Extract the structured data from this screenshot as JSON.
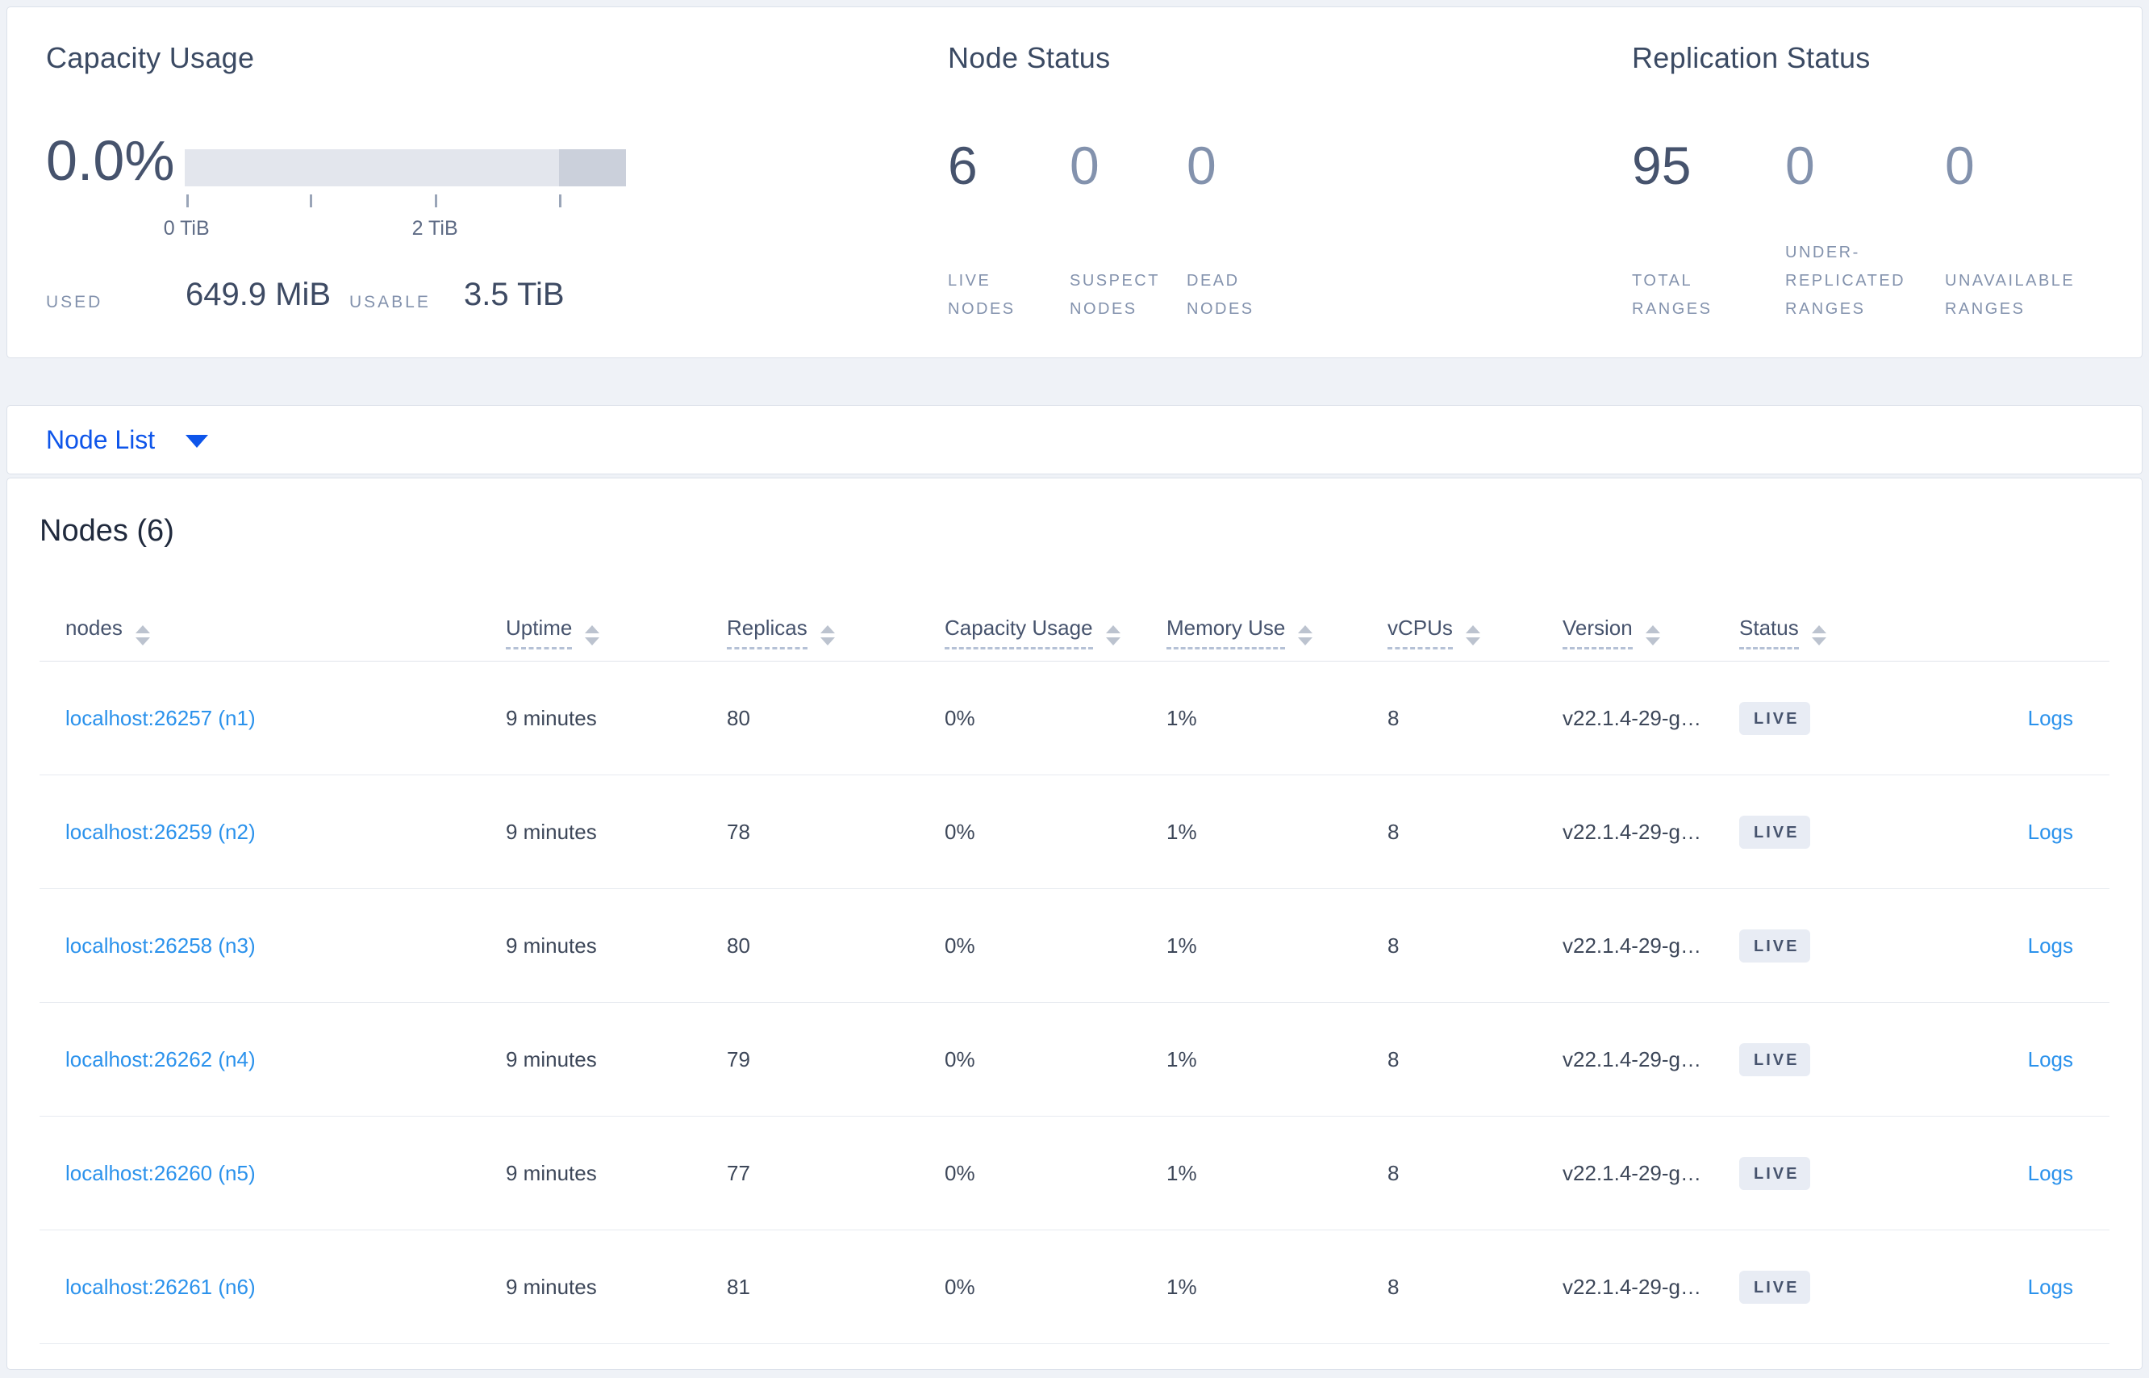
{
  "theme": {
    "accent_blue": "#0e55ea",
    "link_blue": "#2b92ec",
    "badge_bg": "#e8ecf4",
    "text_dark": "#46536d",
    "text_muted": "#8392ad"
  },
  "summary": {
    "capacity": {
      "title": "Capacity Usage",
      "percent": "0.0%",
      "used_label": "USED",
      "used_value": "649.9 MiB",
      "usable_label": "USABLE",
      "usable_value": "3.5 TiB",
      "bar": {
        "segments": [
          {
            "shade": "light",
            "width_pct": 84.8
          },
          {
            "shade": "dark",
            "width_pct": 15.2
          }
        ],
        "ticks": [
          {
            "pct": 0.4,
            "label": "0 TiB"
          },
          {
            "pct": 28.3,
            "label": ""
          },
          {
            "pct": 56.7,
            "label": "2 TiB"
          },
          {
            "pct": 84.8,
            "label": ""
          }
        ]
      }
    },
    "node_status": {
      "title": "Node Status",
      "metrics": [
        {
          "value": "6",
          "muted": false,
          "lines": [
            "LIVE",
            "NODES"
          ]
        },
        {
          "value": "0",
          "muted": true,
          "lines": [
            "SUSPECT",
            "NODES"
          ]
        },
        {
          "value": "0",
          "muted": true,
          "lines": [
            "DEAD",
            "NODES"
          ]
        }
      ]
    },
    "replication": {
      "title": "Replication Status",
      "metrics": [
        {
          "value": "95",
          "muted": false,
          "lines": [
            "TOTAL",
            "RANGES"
          ]
        },
        {
          "value": "0",
          "muted": true,
          "lines": [
            "UNDER-",
            "REPLICATED",
            "RANGES"
          ]
        },
        {
          "value": "0",
          "muted": true,
          "lines": [
            "UNAVAILABLE",
            "RANGES"
          ]
        }
      ]
    }
  },
  "node_list": {
    "label": "Node List"
  },
  "table": {
    "title": "Nodes (6)",
    "columns": [
      {
        "label": "nodes",
        "dashed": false
      },
      {
        "label": "Uptime",
        "dashed": true
      },
      {
        "label": "Replicas",
        "dashed": true
      },
      {
        "label": "Capacity Usage",
        "dashed": true
      },
      {
        "label": "Memory Use",
        "dashed": true
      },
      {
        "label": "vCPUs",
        "dashed": true
      },
      {
        "label": "Version",
        "dashed": true
      },
      {
        "label": "Status",
        "dashed": true
      }
    ],
    "rows": [
      {
        "node": "localhost:26257 (n1)",
        "uptime": "9 minutes",
        "replicas": "80",
        "capacity": "0%",
        "memory": "1%",
        "vcpus": "8",
        "version": "v22.1.4-29-g…",
        "status": "LIVE",
        "logs": "Logs"
      },
      {
        "node": "localhost:26259 (n2)",
        "uptime": "9 minutes",
        "replicas": "78",
        "capacity": "0%",
        "memory": "1%",
        "vcpus": "8",
        "version": "v22.1.4-29-g…",
        "status": "LIVE",
        "logs": "Logs"
      },
      {
        "node": "localhost:26258 (n3)",
        "uptime": "9 minutes",
        "replicas": "80",
        "capacity": "0%",
        "memory": "1%",
        "vcpus": "8",
        "version": "v22.1.4-29-g…",
        "status": "LIVE",
        "logs": "Logs"
      },
      {
        "node": "localhost:26262 (n4)",
        "uptime": "9 minutes",
        "replicas": "79",
        "capacity": "0%",
        "memory": "1%",
        "vcpus": "8",
        "version": "v22.1.4-29-g…",
        "status": "LIVE",
        "logs": "Logs"
      },
      {
        "node": "localhost:26260 (n5)",
        "uptime": "9 minutes",
        "replicas": "77",
        "capacity": "0%",
        "memory": "1%",
        "vcpus": "8",
        "version": "v22.1.4-29-g…",
        "status": "LIVE",
        "logs": "Logs"
      },
      {
        "node": "localhost:26261 (n6)",
        "uptime": "9 minutes",
        "replicas": "81",
        "capacity": "0%",
        "memory": "1%",
        "vcpus": "8",
        "version": "v22.1.4-29-g…",
        "status": "LIVE",
        "logs": "Logs"
      }
    ]
  }
}
